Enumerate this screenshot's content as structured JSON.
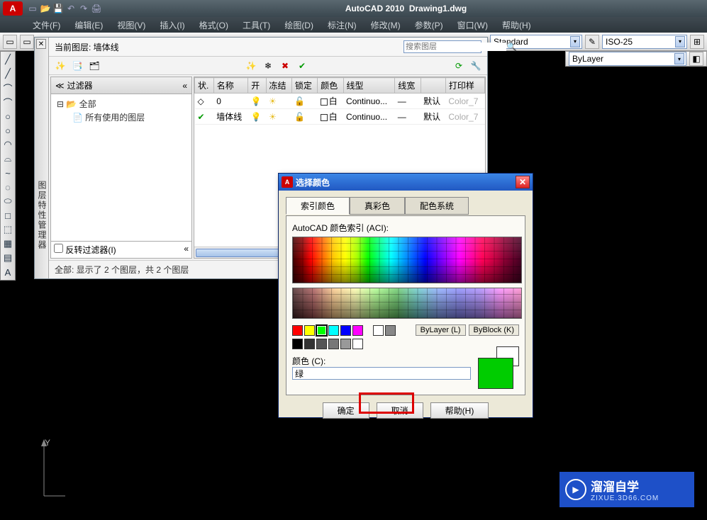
{
  "app": {
    "title": "AutoCAD 2010",
    "doc": "Drawing1.dwg"
  },
  "menus": [
    "文件(F)",
    "编辑(E)",
    "视图(V)",
    "插入(I)",
    "格式(O)",
    "工具(T)",
    "绘图(D)",
    "标注(N)",
    "修改(M)",
    "参数(P)",
    "窗口(W)",
    "帮助(H)"
  ],
  "styleCombos": {
    "text": "Standard",
    "dim": "ISO-25",
    "layer": "ByLayer"
  },
  "leftTools": [
    "╱",
    "╱",
    "⌒",
    "⌒",
    "○",
    "○",
    "◠",
    "⌓",
    "~",
    "◌",
    "⬭",
    "□",
    "⬚",
    "▦",
    "▤",
    "A"
  ],
  "layerMgr": {
    "sidebarLabel": "图层特性管理器",
    "currentLayerLabel": "当前图层: 墙体线",
    "searchPlaceholder": "搜索图层",
    "filterHeader": "过滤器",
    "tree": {
      "root": "全部",
      "child": "所有使用的图层"
    },
    "invertFilter": "反转过滤器(I)",
    "columns": [
      "状.",
      "名称",
      "开",
      "冻结",
      "锁定",
      "颜色",
      "线型",
      "线宽",
      "打印样"
    ],
    "rows": [
      {
        "status": "",
        "name": "0",
        "on": "💡",
        "freeze": "☀",
        "lock": "🔓",
        "colorSwatch": "#fff",
        "colorName": "白",
        "linetype": "Continuo...",
        "lineweight": "—",
        "default": "默认",
        "plot": "Color_7"
      },
      {
        "status": "✔",
        "name": "墙体线",
        "on": "💡",
        "freeze": "☀",
        "lock": "🔓",
        "colorSwatch": "#fff",
        "colorName": "白",
        "linetype": "Continuo...",
        "lineweight": "—",
        "default": "默认",
        "plot": "Color_7"
      }
    ],
    "status": "全部: 显示了 2 个图层，共 2 个图层"
  },
  "colorDlg": {
    "title": "选择颜色",
    "tabs": [
      "索引颜色",
      "真彩色",
      "配色系统"
    ],
    "aciLabel": "AutoCAD 颜色索引 (ACI):",
    "stdColors": [
      "#f00",
      "#ff0",
      "#0f0",
      "#0ff",
      "#00f",
      "#f0f"
    ],
    "selectedStdIndex": 2,
    "grayColors": [
      "#fff",
      "#888"
    ],
    "grays2": [
      "#000",
      "#333",
      "#555",
      "#777",
      "#999",
      "#fff"
    ],
    "byLayer": "ByLayer (L)",
    "byBlock": "ByBlock (K)",
    "colorLabel": "颜色 (C):",
    "colorValue": "绿",
    "previewNew": "#00d000",
    "previewOld": "#ffffff",
    "buttons": {
      "ok": "确定",
      "cancel": "取消",
      "help": "帮助(H)"
    }
  },
  "watermark": {
    "brand": "溜溜自学",
    "url": "ZIXUE.3D66.COM"
  },
  "ucs": {
    "y": "Y"
  }
}
